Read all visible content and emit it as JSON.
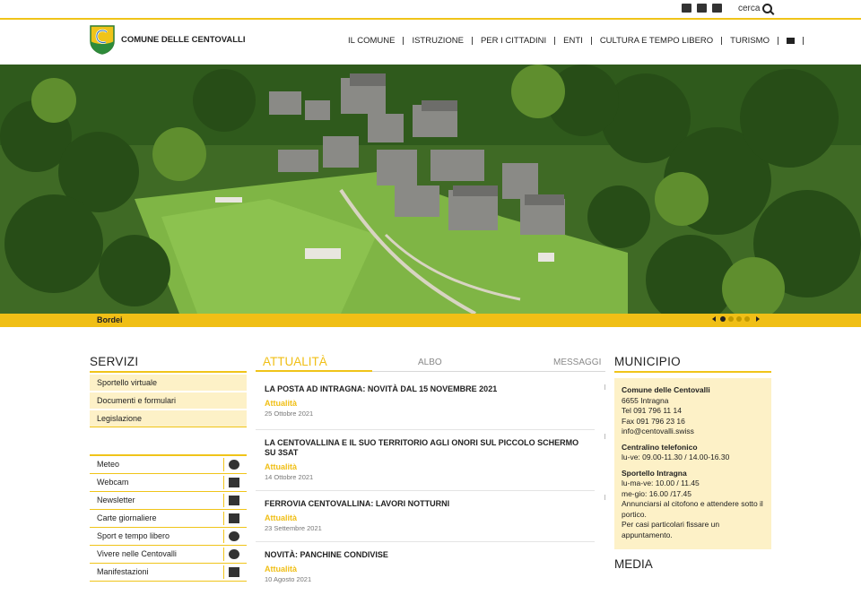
{
  "topbar": {
    "search_label": "cerca"
  },
  "header": {
    "site_name": "COMUNE DELLE CENTOVALLI",
    "nav": [
      "IL COMUNE",
      "ISTRUZIONE",
      "PER I CITTADINI",
      "ENTI",
      "CULTURA E TEMPO LIBERO",
      "TURISMO"
    ]
  },
  "hero": {
    "caption": "Bordei",
    "slide_count": 4,
    "active_slide": 1
  },
  "servizi": {
    "title": "SERVIZI",
    "links": [
      "Sportello virtuale",
      "Documenti e formulari",
      "Legislazione"
    ],
    "items": [
      "Meteo",
      "Webcam",
      "Newsletter",
      "Carte giornaliere",
      "Sport e tempo libero",
      "Vivere nelle Centovalli",
      "Manifestazioni"
    ]
  },
  "news": {
    "tabs": [
      "ATTUALITÀ",
      "ALBO",
      "MESSAGGI"
    ],
    "items": [
      {
        "title": "LA POSTA AD INTRAGNA: NOVITÀ DAL 15 NOVEMBRE 2021",
        "category": "Attualità",
        "date": "25 Ottobre 2021"
      },
      {
        "title": "LA CENTOVALLINA E IL SUO TERRITORIO AGLI ONORI SUL PICCOLO SCHERMO SU 3SAT",
        "category": "Attualità",
        "date": "14 Ottobre 2021"
      },
      {
        "title": "FERROVIA CENTOVALLINA: LAVORI NOTTURNI",
        "category": "Attualità",
        "date": "23 Settembre 2021"
      },
      {
        "title": "NOVITÀ: PANCHINE CONDIVISE",
        "category": "Attualità",
        "date": "10 Agosto 2021"
      }
    ]
  },
  "municipio": {
    "title": "MUNICIPIO",
    "name": "Comune delle Centovalli",
    "address": "6655 Intragna",
    "tel": "Tel 091 796 11 14",
    "fax": "Fax 091 796 23 16",
    "email": "info@centovalli.swiss",
    "centralino_title": "Centralino telefonico",
    "centralino_hours": "lu-ve: 09.00-11.30 / 14.00-16.30",
    "sportello_title": "Sportello Intragna",
    "sportello_line1": "lu-ma-ve: 10.00 / 11.45",
    "sportello_line2": "me-gio: 16.00 /17.45",
    "sportello_note1": "Annunciarsi al citofono e attendere sotto il portico.",
    "sportello_note2": "Per casi particolari fissare un appuntamento."
  },
  "media": {
    "title": "MEDIA"
  },
  "colors": {
    "accent": "#f0bf16",
    "panel": "#fdf1c7"
  }
}
